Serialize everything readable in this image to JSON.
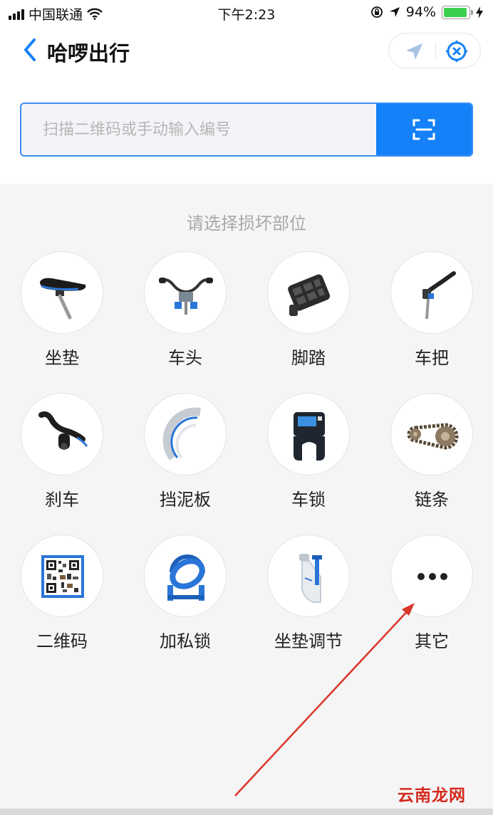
{
  "status_bar": {
    "carrier": "中国联通",
    "time": "下午2:23",
    "battery": "94%",
    "battery_level": 0.94
  },
  "nav": {
    "title": "哈啰出行",
    "back_icon": "chevron-left-icon",
    "location_icon": "location-arrow-icon",
    "close_icon": "target-close-icon"
  },
  "search": {
    "placeholder": "扫描二维码或手动输入编号",
    "value": "",
    "scan_icon": "scan-icon"
  },
  "section_title": "请选择损坏部位",
  "parts": [
    {
      "label": "坐垫",
      "icon": "seat-icon"
    },
    {
      "label": "车头",
      "icon": "handlebar-icon"
    },
    {
      "label": "脚踏",
      "icon": "pedal-icon"
    },
    {
      "label": "车把",
      "icon": "grip-icon"
    },
    {
      "label": "刹车",
      "icon": "brake-lever-icon"
    },
    {
      "label": "挡泥板",
      "icon": "fender-icon"
    },
    {
      "label": "车锁",
      "icon": "lock-icon"
    },
    {
      "label": "链条",
      "icon": "chain-icon"
    },
    {
      "label": "二维码",
      "icon": "qr-code-icon"
    },
    {
      "label": "加私锁",
      "icon": "private-lock-icon"
    },
    {
      "label": "坐垫调节",
      "icon": "seat-adjust-icon"
    },
    {
      "label": "其它",
      "icon": "more-icon"
    }
  ],
  "watermark": "云南龙网",
  "colors": {
    "accent": "#1581f8",
    "annotation_arrow": "#d9352a",
    "bike_blue": "#2a76d8"
  }
}
